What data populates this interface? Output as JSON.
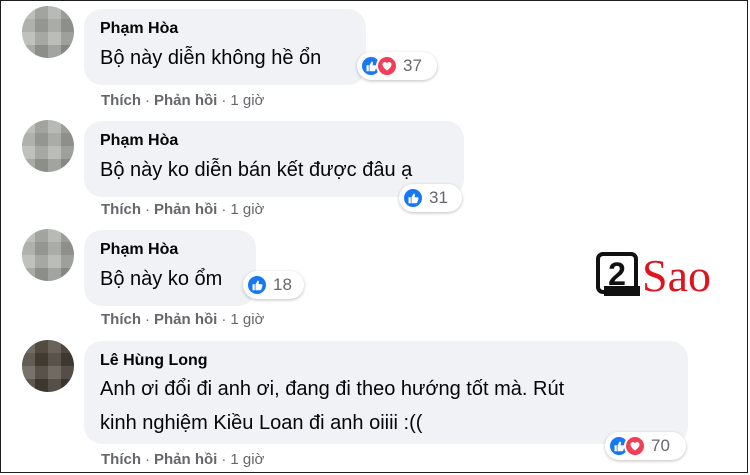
{
  "comments": [
    {
      "author": "Phạm Hòa",
      "text": "Bộ này diễn không hề ổn",
      "reaction_count": "37",
      "reactions": [
        "like-icon",
        "love-icon"
      ],
      "actions": {
        "like": "Thích",
        "reply": "Phản hồi",
        "time": "1 giờ"
      }
    },
    {
      "author": "Phạm Hòa",
      "text": "Bộ này ko diễn bán kết được đâu ạ",
      "reaction_count": "31",
      "reactions": [
        "like-icon"
      ],
      "actions": {
        "like": "Thích",
        "reply": "Phản hồi",
        "time": "1 giờ"
      }
    },
    {
      "author": "Phạm Hòa",
      "text": "Bộ này ko ổm",
      "reaction_count": "18",
      "reactions": [
        "like-icon"
      ],
      "actions": {
        "like": "Thích",
        "reply": "Phản hồi",
        "time": "1 giờ"
      }
    },
    {
      "author": "Lê Hùng Long",
      "text_lines": [
        "Anh ơi đổi đi anh ơi, đang đi theo hướng tốt mà. Rút",
        "kinh nghiệm Kiều Loan đi anh oiiii :(("
      ],
      "reaction_count": "70",
      "reactions": [
        "like-icon",
        "love-icon"
      ],
      "actions": {
        "like": "Thích",
        "reply": "Phản hồi",
        "time": "1 giờ"
      }
    }
  ],
  "watermark": {
    "digit": "2",
    "word": "Sao"
  },
  "colors": {
    "like": "#1877f2",
    "love": "#f33e58",
    "bubble": "#f0f2f5",
    "meta": "#65676b",
    "brand_red": "#e0141e"
  }
}
